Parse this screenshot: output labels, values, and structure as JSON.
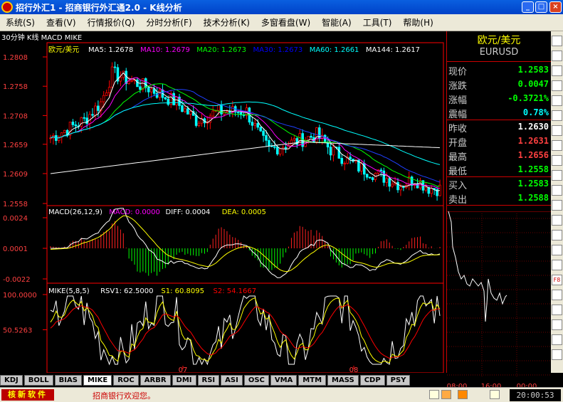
{
  "window": {
    "title": "招行外汇1 - 招商银行外汇通2.0 - K线分析",
    "min": "_",
    "max": "□",
    "close": "×"
  },
  "menu": [
    {
      "label": "系统(S)"
    },
    {
      "label": "查看(V)"
    },
    {
      "label": "行情报价(Q)"
    },
    {
      "label": "分时分析(F)"
    },
    {
      "label": "技术分析(K)"
    },
    {
      "label": "多窗看盘(W)"
    },
    {
      "label": "智能(A)"
    },
    {
      "label": "工具(T)"
    },
    {
      "label": "帮助(H)"
    }
  ],
  "chart": {
    "period_title": "30分钟 K线 MACD MIKE",
    "main_legend": {
      "symbol": "欧元/美元",
      "items": [
        {
          "text": "MA5: 1.2678",
          "color": "#ffffff"
        },
        {
          "text": "MA10: 1.2679",
          "color": "#ff00ff"
        },
        {
          "text": "MA20: 1.2673",
          "color": "#00ff00"
        },
        {
          "text": "MA30: 1.2673",
          "color": "#0000ff"
        },
        {
          "text": "MA60: 1.2661",
          "color": "#00ffff"
        },
        {
          "text": "MA144: 1.2617",
          "color": "#ffffff"
        }
      ]
    },
    "main_axis": [
      "1.2808",
      "1.2758",
      "1.2708",
      "1.2659",
      "1.2609",
      "1.2558"
    ],
    "macd_legend": [
      {
        "text": "MACD(26,12,9)",
        "color": "#ffffff"
      },
      {
        "text": "MACD: 0.0000",
        "color": "#ff00ff"
      },
      {
        "text": "DIFF: 0.0004",
        "color": "#ffffff"
      },
      {
        "text": "DEA: 0.0005",
        "color": "#ffff00"
      }
    ],
    "macd_axis": [
      "0.0024",
      "0.0001",
      "-0.0022"
    ],
    "mike_legend": [
      {
        "text": "MIKE(5,8,5)",
        "color": "#ffffff"
      },
      {
        "text": "RSV1: 62.5000",
        "color": "#ffffff"
      },
      {
        "text": "S1: 60.8095",
        "color": "#ffff00"
      },
      {
        "text": "S2: 54.1667",
        "color": "#ff0000"
      }
    ],
    "mike_axis": [
      "100.0000",
      "50.5263"
    ],
    "dates": [
      "07",
      "08"
    ],
    "colors": {
      "up": "#ff0000",
      "down": "#00ffff",
      "grid": "#800000",
      "axis": "#ff0000"
    }
  },
  "quote": {
    "name": "欧元/美元",
    "code": "EURUSD",
    "rows": [
      {
        "label": "现价",
        "value": "1.2583",
        "color": "#00ff00"
      },
      {
        "label": "涨跌",
        "value": "0.0047",
        "color": "#00ff00"
      },
      {
        "label": "涨幅",
        "value": "-0.3721%",
        "color": "#00ff00"
      },
      {
        "label": "震幅",
        "value": "0.78%",
        "color": "#00ffff"
      },
      {
        "label": "昨收",
        "value": "1.2630",
        "color": "#ffffff"
      },
      {
        "label": "开盘",
        "value": "1.2631",
        "color": "#ff4040"
      },
      {
        "label": "最高",
        "value": "1.2656",
        "color": "#ff4040"
      },
      {
        "label": "最低",
        "value": "1.2558",
        "color": "#00ff00"
      },
      {
        "label": "买入",
        "value": "1.2583",
        "color": "#00ff00"
      },
      {
        "label": "卖出",
        "value": "1.2588",
        "color": "#00ff00"
      }
    ],
    "mini_times": [
      "08:00",
      "16:00",
      "00:00"
    ]
  },
  "tabs": [
    "KDJ",
    "BOLL",
    "BIAS",
    "MIKE",
    "ROC",
    "ARBR",
    "DMI",
    "RSI",
    "ASI",
    "OSC",
    "VMA",
    "MTM",
    "MASS",
    "CDP",
    "PSY"
  ],
  "active_tab": "MIKE",
  "status": {
    "logo": "核新软件",
    "welcome": "招商银行欢迎您。",
    "time": "20:00:53"
  },
  "toolbar_icons": [
    "cursor-icon",
    "zoom-icon",
    "tool3-icon",
    "tool4-icon",
    "tool5-icon",
    "tool6-icon",
    "tool7-icon",
    "tool8-icon",
    "tool9-icon",
    "tool10-icon",
    "tool11-icon",
    "tool12-icon",
    "tool13-icon",
    "tool14-icon",
    "tool15-icon",
    "tool16-icon",
    "f8-icon",
    "tool18-icon",
    "tool19-icon",
    "tool20-icon",
    "tool21-icon",
    "tool22-icon"
  ]
}
